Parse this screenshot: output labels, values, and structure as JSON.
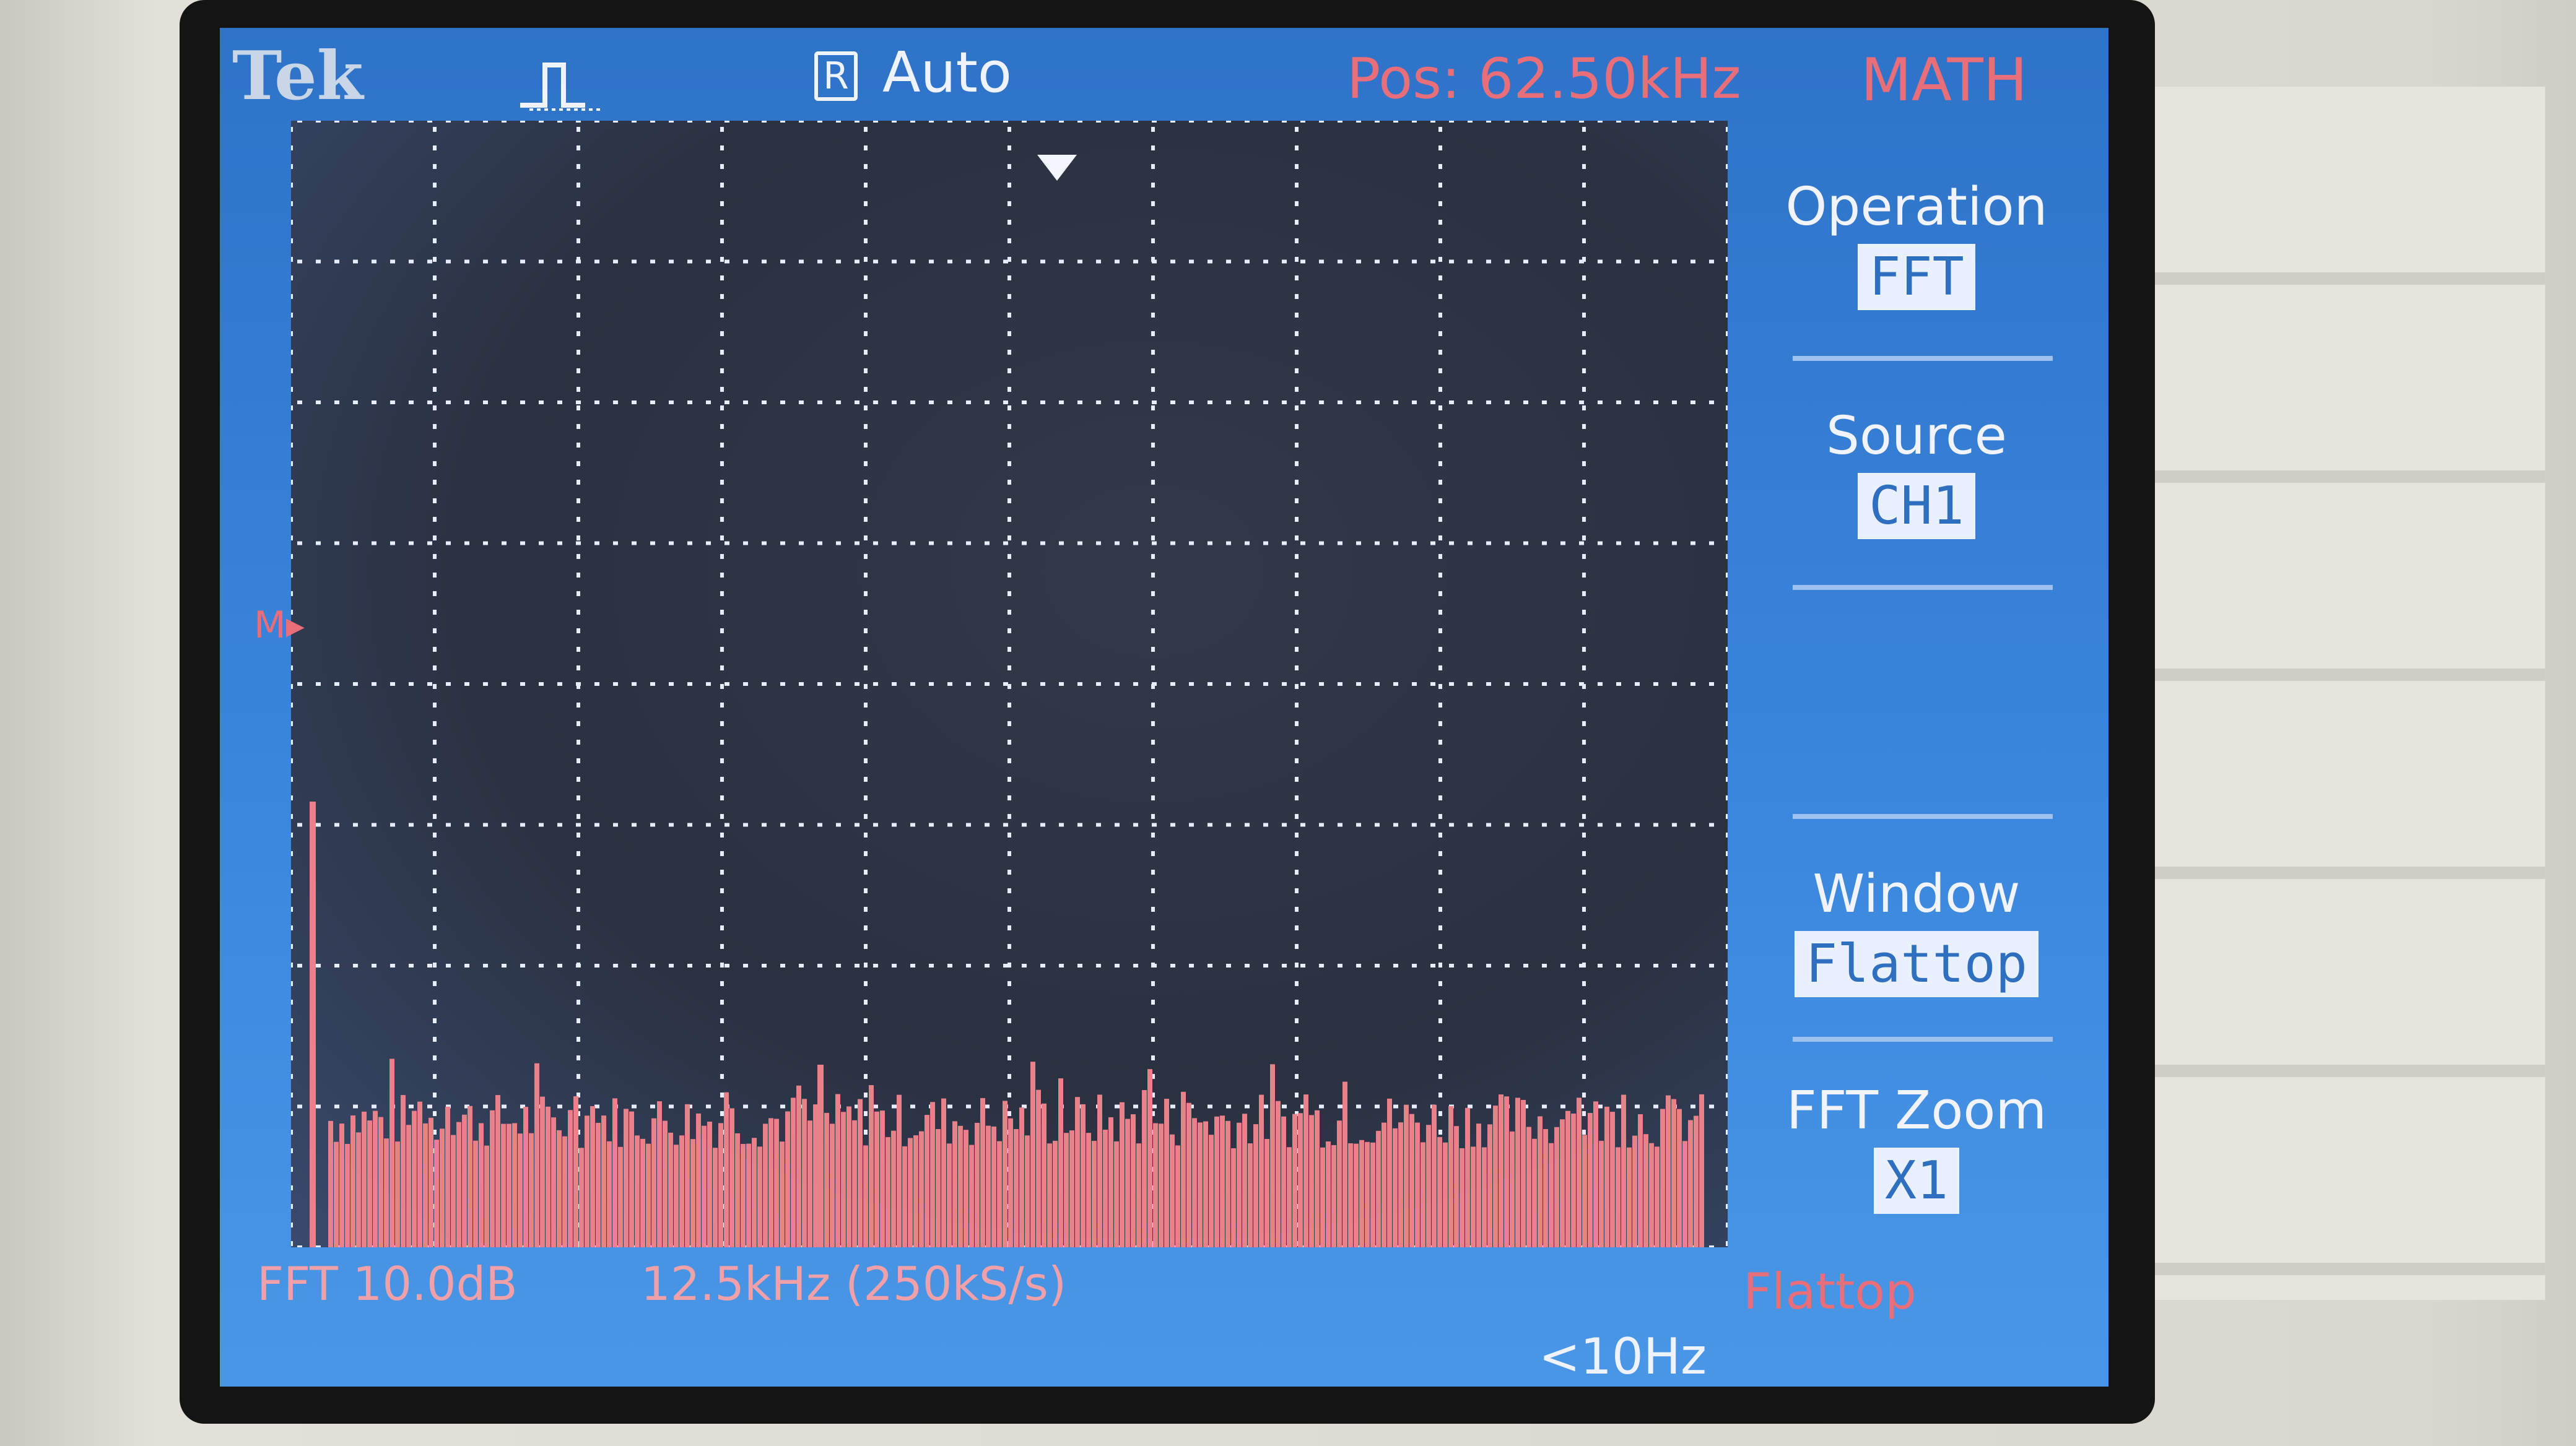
{
  "header": {
    "brand": "Tek",
    "trigger_icon": "pulse-trigger-icon",
    "run_state_badge": "R",
    "run_state": "Auto",
    "position": "Pos: 62.50kHz",
    "menu_title": "MATH"
  },
  "menu": [
    {
      "label": "Operation",
      "value": "FFT"
    },
    {
      "label": "Source",
      "value": "CH1"
    },
    {
      "label": "",
      "value": ""
    },
    {
      "label": "Window",
      "value": "Flattop"
    },
    {
      "label": "FFT Zoom",
      "value": "X1"
    }
  ],
  "footer": {
    "fft_scale": "FFT 10.0dB",
    "fft_span": "12.5kHz (250kS/s)",
    "window": "Flattop",
    "resolution": "<10Hz"
  },
  "markers": {
    "reference": "M▸"
  },
  "colors": {
    "screen_blue": "#3a86dd",
    "graticule_bg": "#2a3140",
    "trace": "#e8818a",
    "accent_red": "#e86e7a",
    "grid_dots": "#e7ecff"
  }
}
